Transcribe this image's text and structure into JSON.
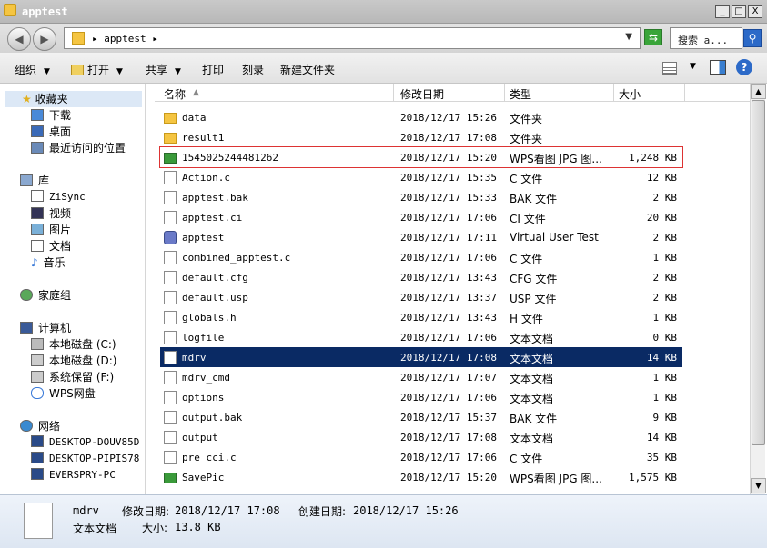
{
  "window": {
    "title": "apptest",
    "buttons": [
      "_",
      "□",
      "X"
    ]
  },
  "address": {
    "crumb": "▸ apptest ▸",
    "search_placeholder": "搜索 a..."
  },
  "toolbar": {
    "organize": "组织",
    "open": "打开",
    "share": "共享",
    "print": "打印",
    "burn": "刻录",
    "new_folder": "新建文件夹"
  },
  "nav": {
    "favorites": "收藏夹",
    "downloads": "下载",
    "desktop": "桌面",
    "recent": "最近访问的位置",
    "libraries": "库",
    "zisync": "ZiSync",
    "videos": "视频",
    "pictures": "图片",
    "documents": "文档",
    "music": "音乐",
    "homegroup": "家庭组",
    "computer": "计算机",
    "drive_c": "本地磁盘 (C:)",
    "drive_d": "本地磁盘 (D:)",
    "drive_f": "系统保留 (F:)",
    "wps_cloud": "WPS网盘",
    "network": "网络",
    "pc1": "DESKTOP-DOUV85D",
    "pc2": "DESKTOP-PIPIS78",
    "pc3": "EVERSPRY-PC"
  },
  "columns": {
    "name": "名称",
    "modified": "修改日期",
    "type": "类型",
    "size": "大小"
  },
  "files": [
    {
      "name": "data",
      "modified": "2018/12/17 15:26",
      "type": "文件夹",
      "size": "",
      "icon": "folder-icon"
    },
    {
      "name": "result1",
      "modified": "2018/12/17 17:08",
      "type": "文件夹",
      "size": "",
      "icon": "folder-icon"
    },
    {
      "name": "1545025244481262",
      "modified": "2018/12/17 15:20",
      "type": "WPS看图 JPG 图...",
      "size": "1,248 KB",
      "icon": "jpg-icon"
    },
    {
      "name": "Action.c",
      "modified": "2018/12/17 15:35",
      "type": "C 文件",
      "size": "12 KB",
      "icon": "document-icon"
    },
    {
      "name": "apptest.bak",
      "modified": "2018/12/17 15:33",
      "type": "BAK 文件",
      "size": "2 KB",
      "icon": "document-icon"
    },
    {
      "name": "apptest.ci",
      "modified": "2018/12/17 17:06",
      "type": "CI 文件",
      "size": "20 KB",
      "icon": "document-icon"
    },
    {
      "name": "apptest",
      "modified": "2018/12/17 17:11",
      "type": "Virtual User Test",
      "size": "2 KB",
      "icon": "vuser-icon"
    },
    {
      "name": "combined_apptest.c",
      "modified": "2018/12/17 17:06",
      "type": "C 文件",
      "size": "1 KB",
      "icon": "document-icon"
    },
    {
      "name": "default.cfg",
      "modified": "2018/12/17 13:43",
      "type": "CFG 文件",
      "size": "2 KB",
      "icon": "document-icon"
    },
    {
      "name": "default.usp",
      "modified": "2018/12/17 13:37",
      "type": "USP 文件",
      "size": "2 KB",
      "icon": "document-icon"
    },
    {
      "name": "globals.h",
      "modified": "2018/12/17 13:43",
      "type": "H 文件",
      "size": "1 KB",
      "icon": "document-icon"
    },
    {
      "name": "logfile",
      "modified": "2018/12/17 17:06",
      "type": "文本文档",
      "size": "0 KB",
      "icon": "document-icon"
    },
    {
      "name": "mdrv",
      "modified": "2018/12/17 17:08",
      "type": "文本文档",
      "size": "14 KB",
      "icon": "document-icon"
    },
    {
      "name": "mdrv_cmd",
      "modified": "2018/12/17 17:07",
      "type": "文本文档",
      "size": "1 KB",
      "icon": "document-icon"
    },
    {
      "name": "options",
      "modified": "2018/12/17 17:06",
      "type": "文本文档",
      "size": "1 KB",
      "icon": "document-icon"
    },
    {
      "name": "output.bak",
      "modified": "2018/12/17 15:37",
      "type": "BAK 文件",
      "size": "9 KB",
      "icon": "document-icon"
    },
    {
      "name": "output",
      "modified": "2018/12/17 17:08",
      "type": "文本文档",
      "size": "14 KB",
      "icon": "document-icon"
    },
    {
      "name": "pre_cci.c",
      "modified": "2018/12/17 17:06",
      "type": "C 文件",
      "size": "35 KB",
      "icon": "document-icon"
    },
    {
      "name": "SavePic",
      "modified": "2018/12/17 15:20",
      "type": "WPS看图 JPG 图...",
      "size": "1,575 KB",
      "icon": "jpg-icon"
    }
  ],
  "selected_file": "mdrv",
  "details": {
    "name": "mdrv",
    "type": "文本文档",
    "modified_label": "修改日期:",
    "modified": "2018/12/17 17:08",
    "created_label": "创建日期:",
    "created": "2018/12/17 15:26",
    "size_label": "大小:",
    "size": "13.8 KB"
  },
  "colors": {
    "selection": "#0a2a64",
    "highlight_box": "#dd3333",
    "title_bar": "#c0c0c0"
  }
}
